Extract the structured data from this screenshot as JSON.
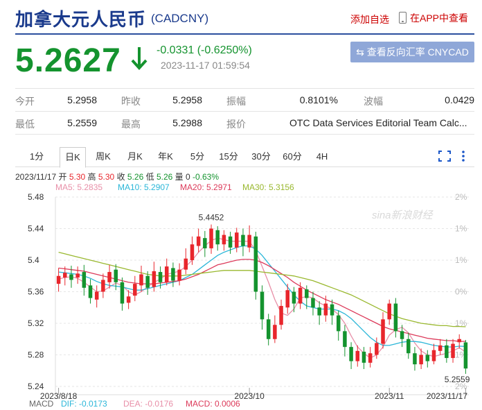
{
  "header": {
    "title": "加拿大元人民币",
    "code": "(CADCNY)",
    "add_favorite": "添加自选",
    "app_view": "在APP中查看"
  },
  "quote": {
    "price": "5.2627",
    "change": "-0.0331 (-0.6250%)",
    "timestamp": "2023-11-17 01:59:54",
    "reverse_button": "⇆ 查看反向汇率 CNYCAD",
    "stats_row1": [
      {
        "label": "今开",
        "value": "5.2958"
      },
      {
        "label": "昨收",
        "value": "5.2958"
      },
      {
        "label": "振幅",
        "value": "0.8101%"
      },
      {
        "label": "波幅",
        "value": "0.0429"
      }
    ],
    "stats_row2": [
      {
        "label": "最低",
        "value": "5.2559"
      },
      {
        "label": "最高",
        "value": "5.2988"
      },
      {
        "label": "报价",
        "value": "OTC Data Services Editorial Team Calc..."
      }
    ]
  },
  "colors": {
    "up": "#e8262c",
    "down": "#14932e",
    "title": "#1a3a8c",
    "ma5": "#e88fa8",
    "ma10": "#2ab6d8",
    "ma20": "#dc3a5a",
    "ma30": "#99b82e"
  },
  "tabs": [
    {
      "label": "1分",
      "active": false
    },
    {
      "label": "日K",
      "active": true
    },
    {
      "label": "周K",
      "active": false
    },
    {
      "label": "月K",
      "active": false
    },
    {
      "label": "年K",
      "active": false
    },
    {
      "label": "5分",
      "active": false
    },
    {
      "label": "15分",
      "active": false
    },
    {
      "label": "30分",
      "active": false
    },
    {
      "label": "60分",
      "active": false
    },
    {
      "label": "4H",
      "active": false
    }
  ],
  "chart_info": {
    "ohlc_line": [
      {
        "text": "2023/11/17 开 ",
        "color": "#333"
      },
      {
        "text": "5.30",
        "color": "#e8262c"
      },
      {
        "text": " 高 ",
        "color": "#333"
      },
      {
        "text": "5.30",
        "color": "#e8262c"
      },
      {
        "text": " 收 ",
        "color": "#333"
      },
      {
        "text": "5.26",
        "color": "#14932e"
      },
      {
        "text": " 低 ",
        "color": "#333"
      },
      {
        "text": "5.26",
        "color": "#14932e"
      },
      {
        "text": " 量 0 ",
        "color": "#333"
      },
      {
        "text": "-0.63%",
        "color": "#14932e"
      }
    ],
    "ma_legend": [
      {
        "text": "MA5: 5.2835",
        "color": "#e88fa8"
      },
      {
        "text": "MA10: 5.2907",
        "color": "#2ab6d8"
      },
      {
        "text": "MA20: 5.2971",
        "color": "#dc3a5a"
      },
      {
        "text": "MA30: 5.3156",
        "color": "#99b82e"
      }
    ],
    "macd_legend": [
      {
        "text": "MACD",
        "color": "#666"
      },
      {
        "text": "DIF: -0.0173",
        "color": "#2ab6d8"
      },
      {
        "text": "DEA: -0.0176",
        "color": "#e88fa8"
      },
      {
        "text": "MACD: 0.0006",
        "color": "#dc3a5a"
      }
    ],
    "watermark": "sina新浪财经"
  },
  "chart_data": {
    "type": "candlestick",
    "ylim": [
      5.24,
      5.48
    ],
    "y_ticks": [
      "5.48",
      "5.44",
      "5.4",
      "5.36",
      "5.32",
      "5.28",
      "5.24"
    ],
    "right_ticks": [
      "2%",
      "1%",
      "1%",
      "0%",
      "1%",
      "1%",
      "2%"
    ],
    "x_ticks": [
      {
        "label": "2023/8/18",
        "index": 0
      },
      {
        "label": "2023/10",
        "index": 30
      },
      {
        "label": "2023/11",
        "index": 52
      },
      {
        "label": "2023/11/17",
        "index": 64
      }
    ],
    "annotations": [
      {
        "text": "5.4452",
        "index": 24,
        "value": 5.4452
      },
      {
        "text": "5.2559",
        "index": 64,
        "value": 5.2559
      }
    ],
    "candles": [
      [
        5.37,
        5.38,
        5.39,
        5.36
      ],
      [
        5.378,
        5.384,
        5.392,
        5.368
      ],
      [
        5.382,
        5.375,
        5.393,
        5.365
      ],
      [
        5.378,
        5.383,
        5.392,
        5.37
      ],
      [
        5.385,
        5.365,
        5.394,
        5.355
      ],
      [
        5.368,
        5.352,
        5.376,
        5.345
      ],
      [
        5.35,
        5.36,
        5.368,
        5.34
      ],
      [
        5.36,
        5.375,
        5.383,
        5.352
      ],
      [
        5.372,
        5.385,
        5.394,
        5.364
      ],
      [
        5.388,
        5.372,
        5.395,
        5.362
      ],
      [
        5.372,
        5.345,
        5.378,
        5.336
      ],
      [
        5.346,
        5.354,
        5.362,
        5.338
      ],
      [
        5.355,
        5.37,
        5.38,
        5.348
      ],
      [
        5.368,
        5.382,
        5.393,
        5.36
      ],
      [
        5.38,
        5.365,
        5.386,
        5.356
      ],
      [
        5.366,
        5.386,
        5.398,
        5.36
      ],
      [
        5.385,
        5.372,
        5.392,
        5.364
      ],
      [
        5.372,
        5.392,
        5.402,
        5.368
      ],
      [
        5.39,
        5.374,
        5.397,
        5.366
      ],
      [
        5.374,
        5.388,
        5.396,
        5.368
      ],
      [
        5.388,
        5.402,
        5.415,
        5.382
      ],
      [
        5.4,
        5.42,
        5.43,
        5.394
      ],
      [
        5.418,
        5.43,
        5.44,
        5.41
      ],
      [
        5.428,
        5.415,
        5.437,
        5.404
      ],
      [
        5.415,
        5.44,
        5.4452,
        5.408
      ],
      [
        5.438,
        5.42,
        5.443,
        5.412
      ],
      [
        5.42,
        5.432,
        5.438,
        5.412
      ],
      [
        5.43,
        5.416,
        5.436,
        5.408
      ],
      [
        5.416,
        5.435,
        5.441,
        5.41
      ],
      [
        5.432,
        5.418,
        5.44,
        5.405
      ],
      [
        5.416,
        5.432,
        5.444,
        5.41
      ],
      [
        5.43,
        5.36,
        5.436,
        5.35
      ],
      [
        5.36,
        5.325,
        5.368,
        5.312
      ],
      [
        5.325,
        5.3,
        5.332,
        5.292
      ],
      [
        5.3,
        5.318,
        5.33,
        5.295
      ],
      [
        5.318,
        5.342,
        5.35,
        5.312
      ],
      [
        5.34,
        5.362,
        5.37,
        5.332
      ],
      [
        5.36,
        5.345,
        5.366,
        5.334
      ],
      [
        5.345,
        5.365,
        5.372,
        5.338
      ],
      [
        5.363,
        5.352,
        5.368,
        5.338
      ],
      [
        5.352,
        5.34,
        5.36,
        5.33
      ],
      [
        5.34,
        5.33,
        5.348,
        5.318
      ],
      [
        5.33,
        5.345,
        5.355,
        5.322
      ],
      [
        5.344,
        5.33,
        5.35,
        5.318
      ],
      [
        5.33,
        5.31,
        5.336,
        5.298
      ],
      [
        5.31,
        5.29,
        5.318,
        5.278
      ],
      [
        5.29,
        5.272,
        5.296,
        5.262
      ],
      [
        5.272,
        5.285,
        5.292,
        5.265
      ],
      [
        5.284,
        5.27,
        5.29,
        5.262
      ],
      [
        5.27,
        5.282,
        5.29,
        5.264
      ],
      [
        5.28,
        5.295,
        5.302,
        5.275
      ],
      [
        5.294,
        5.325,
        5.334,
        5.288
      ],
      [
        5.325,
        5.345,
        5.35,
        5.318
      ],
      [
        5.345,
        5.31,
        5.352,
        5.302
      ],
      [
        5.31,
        5.3,
        5.318,
        5.29
      ],
      [
        5.3,
        5.282,
        5.308,
        5.275
      ],
      [
        5.282,
        5.268,
        5.29,
        5.26
      ],
      [
        5.268,
        5.28,
        5.288,
        5.262
      ],
      [
        5.28,
        5.272,
        5.286,
        5.264
      ],
      [
        5.272,
        5.286,
        5.294,
        5.268
      ],
      [
        5.285,
        5.292,
        5.3,
        5.28
      ],
      [
        5.292,
        5.276,
        5.3,
        5.27
      ],
      [
        5.276,
        5.294,
        5.3,
        5.27
      ],
      [
        5.296,
        5.3,
        5.306,
        5.288
      ],
      [
        5.2958,
        5.2627,
        5.2988,
        5.2559
      ]
    ],
    "ma_series": [
      {
        "name": "MA5",
        "values": [
          5.376,
          5.378,
          5.379,
          5.377,
          5.372,
          5.366,
          5.36,
          5.361,
          5.366,
          5.371,
          5.368,
          5.36,
          5.356,
          5.36,
          5.366,
          5.372,
          5.376,
          5.382,
          5.384,
          5.386,
          5.392,
          5.4,
          5.41,
          5.418,
          5.425,
          5.428,
          5.426,
          5.424,
          5.424,
          5.424,
          5.424,
          5.412,
          5.392,
          5.372,
          5.35,
          5.333,
          5.33,
          5.338,
          5.352,
          5.354,
          5.352,
          5.346,
          5.342,
          5.338,
          5.331,
          5.32,
          5.304,
          5.29,
          5.282,
          5.276,
          5.28,
          5.29,
          5.305,
          5.312,
          5.315,
          5.308,
          5.295,
          5.285,
          5.28,
          5.278,
          5.28,
          5.282,
          5.285,
          5.289,
          5.2835
        ]
      },
      {
        "name": "MA10",
        "values": [
          5.385,
          5.384,
          5.383,
          5.382,
          5.38,
          5.377,
          5.373,
          5.37,
          5.368,
          5.367,
          5.366,
          5.364,
          5.362,
          5.362,
          5.364,
          5.366,
          5.368,
          5.37,
          5.372,
          5.374,
          5.378,
          5.382,
          5.388,
          5.394,
          5.4,
          5.406,
          5.41,
          5.413,
          5.416,
          5.418,
          5.418,
          5.414,
          5.406,
          5.396,
          5.386,
          5.376,
          5.366,
          5.356,
          5.348,
          5.342,
          5.34,
          5.338,
          5.338,
          5.338,
          5.336,
          5.332,
          5.326,
          5.318,
          5.31,
          5.302,
          5.296,
          5.292,
          5.292,
          5.294,
          5.296,
          5.297,
          5.297,
          5.296,
          5.294,
          5.292,
          5.291,
          5.29,
          5.29,
          5.291,
          5.2907
        ]
      },
      {
        "name": "MA20",
        "values": [
          5.39,
          5.389,
          5.388,
          5.387,
          5.386,
          5.384,
          5.382,
          5.38,
          5.378,
          5.376,
          5.374,
          5.372,
          5.371,
          5.37,
          5.37,
          5.37,
          5.371,
          5.372,
          5.373,
          5.374,
          5.376,
          5.379,
          5.382,
          5.386,
          5.39,
          5.394,
          5.396,
          5.398,
          5.4,
          5.401,
          5.401,
          5.4,
          5.397,
          5.393,
          5.388,
          5.383,
          5.378,
          5.372,
          5.367,
          5.362,
          5.358,
          5.354,
          5.35,
          5.347,
          5.344,
          5.34,
          5.336,
          5.332,
          5.328,
          5.324,
          5.32,
          5.316,
          5.313,
          5.311,
          5.309,
          5.307,
          5.305,
          5.303,
          5.301,
          5.3,
          5.299,
          5.298,
          5.298,
          5.297,
          5.2971
        ]
      },
      {
        "name": "MA30",
        "values": [
          5.41,
          5.408,
          5.406,
          5.404,
          5.402,
          5.4,
          5.398,
          5.396,
          5.394,
          5.392,
          5.39,
          5.388,
          5.386,
          5.384,
          5.382,
          5.381,
          5.38,
          5.38,
          5.38,
          5.38,
          5.381,
          5.382,
          5.383,
          5.384,
          5.385,
          5.386,
          5.387,
          5.387,
          5.387,
          5.387,
          5.387,
          5.386,
          5.385,
          5.384,
          5.383,
          5.382,
          5.381,
          5.38,
          5.378,
          5.376,
          5.374,
          5.371,
          5.368,
          5.365,
          5.362,
          5.359,
          5.356,
          5.352,
          5.348,
          5.344,
          5.34,
          5.336,
          5.332,
          5.329,
          5.326,
          5.324,
          5.322,
          5.32,
          5.319,
          5.318,
          5.317,
          5.317,
          5.316,
          5.316,
          5.3156
        ]
      }
    ]
  }
}
